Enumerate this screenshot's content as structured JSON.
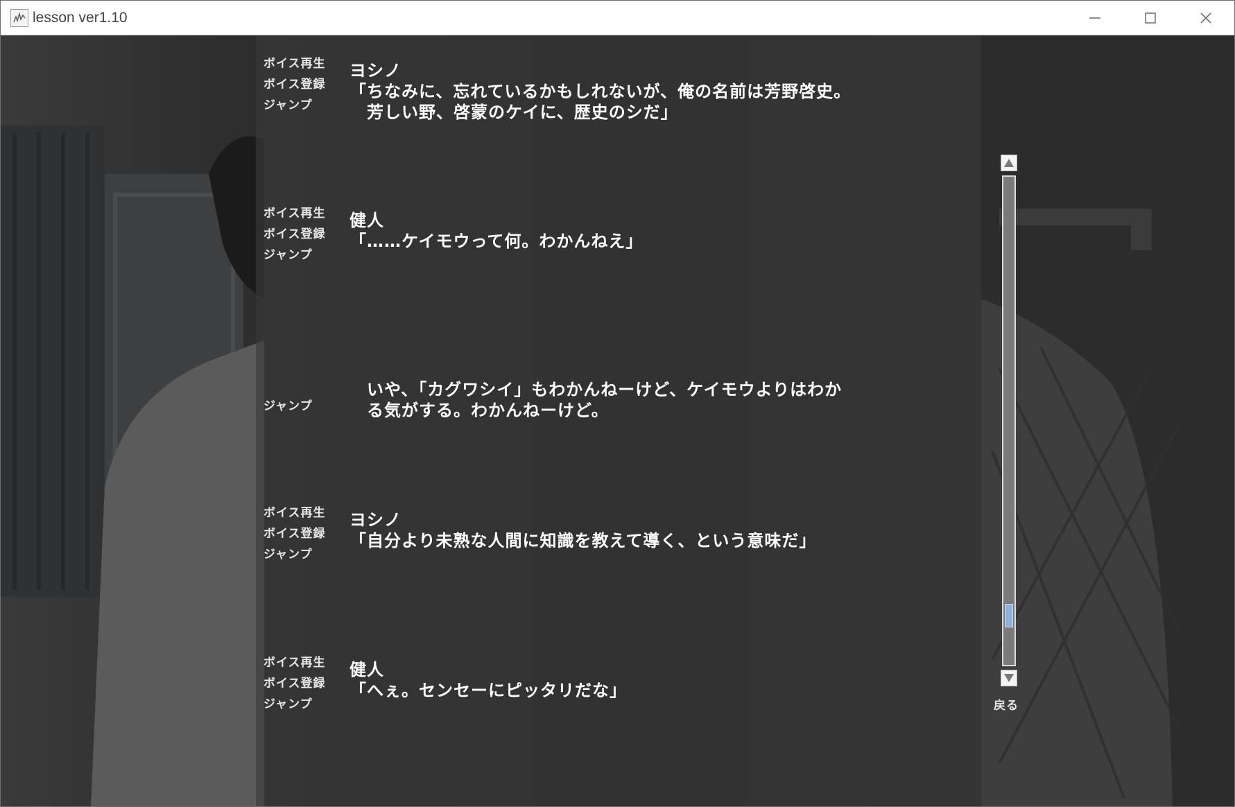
{
  "window": {
    "title": "lesson ver1.10"
  },
  "controls": {
    "voice_play": "ボイス再生",
    "voice_register": "ボイス登録",
    "jump": "ジャンプ",
    "back": "戻る"
  },
  "entries": [
    {
      "speaker": "ヨシノ",
      "lines": [
        "「ちなみに、忘れているかもしれないが、俺の名前は芳野啓史。",
        "　芳しい野、啓蒙のケイに、歴史のシだ」"
      ]
    },
    {
      "speaker": "健人",
      "lines": [
        "「……ケイモウって何。わかんねえ」"
      ]
    },
    {
      "speaker": "",
      "lines": [
        "　いや、「カグワシイ」もわかんねーけど、ケイモウよりはわか",
        "　る気がする。わかんねーけど。"
      ]
    },
    {
      "speaker": "ヨシノ",
      "lines": [
        "「自分より未熟な人間に知識を教えて導く、という意味だ」"
      ]
    },
    {
      "speaker": "健人",
      "lines": [
        "「へぇ。センセーにピッタリだな」"
      ]
    }
  ],
  "colors": {
    "panel": "#3a3a3a",
    "thumb": "#8fb0d8",
    "text": "#ffffff"
  },
  "scrollbar": {
    "position_fraction": 0.92
  }
}
